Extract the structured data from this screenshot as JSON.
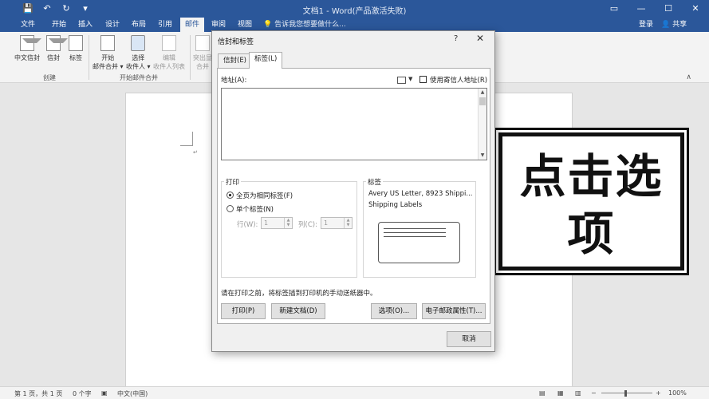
{
  "window": {
    "title": "文档1 - Word(产品激活失败)",
    "controls": {
      "ribbon_options": "▭",
      "minimize": "—",
      "maximize": "☐",
      "close": "✕"
    }
  },
  "qat": {
    "save": "💾",
    "undo": "↶",
    "redo": "↻",
    "customize": "▾"
  },
  "ribbon_tabs": [
    "文件",
    "开始",
    "插入",
    "设计",
    "布局",
    "引用",
    "邮件",
    "审阅",
    "视图"
  ],
  "tell_me": "告诉我您想要做什么...",
  "signin": "登录",
  "share": "共享",
  "ribbon": {
    "create_buttons": [
      "中文信封",
      "信封",
      "标签"
    ],
    "create_group": "创建",
    "merge_buttons": [
      {
        "line1": "开始",
        "line2": "邮件合并 ▾"
      },
      {
        "line1": "选择",
        "line2": "收件人 ▾"
      },
      {
        "line1": "编辑",
        "line2": "收件人列表"
      }
    ],
    "merge_group": "开始邮件合并",
    "partial_button": {
      "line1": "突出显",
      "line2": "合并"
    },
    "collapse": "∧"
  },
  "dialog": {
    "title": "信封和标签",
    "help": "?",
    "close": "✕",
    "tabs": [
      "信封(E)",
      "标签(L)"
    ],
    "address_label": "地址(A):",
    "use_return_address": "使用寄信人地址(R)",
    "address_value": "",
    "print_group": "打印",
    "full_page": "全页为相同标签(F)",
    "single_label": "单个标签(N)",
    "row_label": "行(W):",
    "row_value": "1",
    "col_label": "列(C):",
    "col_value": "1",
    "label_group": "标签",
    "label_line1": "Avery US Letter, 8923 Shippi...",
    "label_line2": "Shipping Labels",
    "notice": "请在打印之前，将标签插到打印机的手动送纸器中。",
    "buttons": {
      "print": "打印(P)",
      "new_doc": "新建文档(D)",
      "options": "选项(O)...",
      "epostage": "电子邮政属性(T)...",
      "cancel": "取消"
    }
  },
  "overlay_text": [
    "点击选",
    "项"
  ],
  "status": {
    "page": "第 1 页，共 1 页",
    "words": "0 个字",
    "language": "中文(中国)",
    "zoom": "100%"
  },
  "colors": {
    "word_blue": "#2b579a",
    "ribbon_bg": "#f3f3f3",
    "dialog_bg": "#f0f0f0"
  }
}
